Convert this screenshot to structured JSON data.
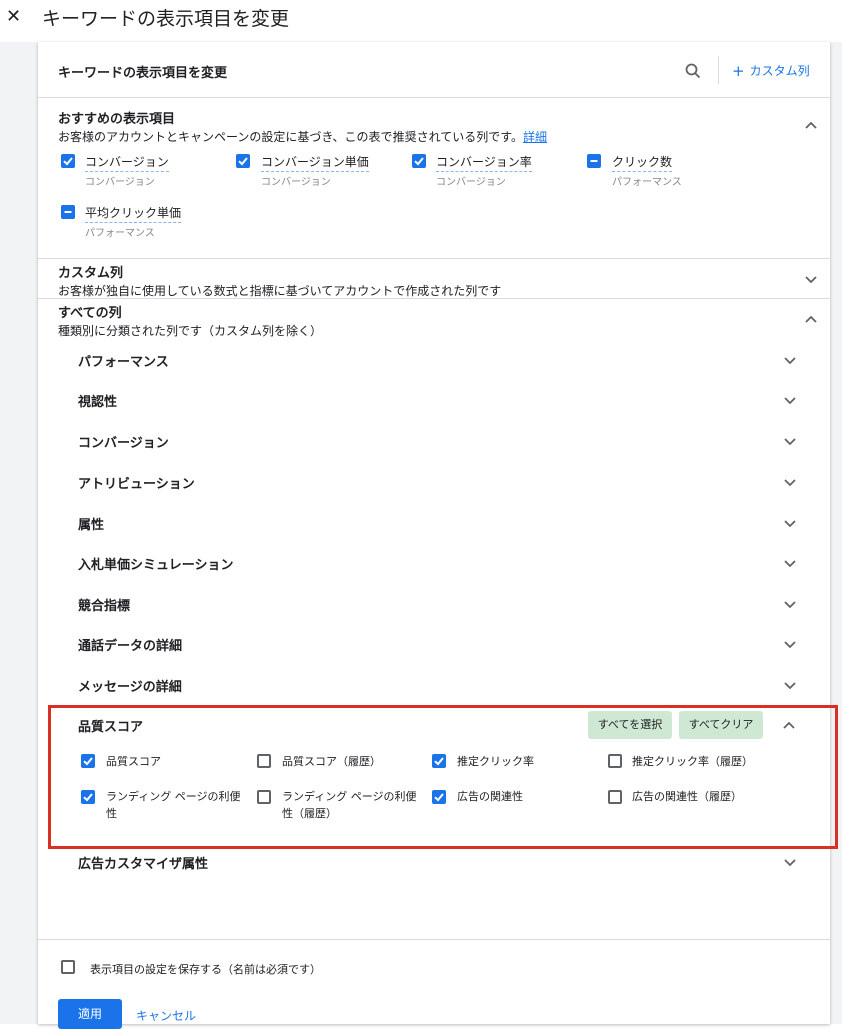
{
  "page": {
    "title": "キーワードの表示項目を変更"
  },
  "panel": {
    "header_title": "キーワードの表示項目を変更",
    "custom_column_button": "カスタム列"
  },
  "recommended": {
    "title": "おすすめの表示項目",
    "description": "お客様のアカウントとキャンペーンの設定に基づき、この表で推奨されている列です。",
    "details_link": "詳細",
    "items": [
      {
        "label": "コンバージョン",
        "category": "コンバージョン",
        "state": "checked"
      },
      {
        "label": "コンバージョン単価",
        "category": "コンバージョン",
        "state": "checked"
      },
      {
        "label": "コンバージョン率",
        "category": "コンバージョン",
        "state": "checked"
      },
      {
        "label": "クリック数",
        "category": "パフォーマンス",
        "state": "indeterminate"
      },
      {
        "label": "平均クリック単価",
        "category": "パフォーマンス",
        "state": "indeterminate"
      }
    ]
  },
  "custom_columns": {
    "title": "カスタム列",
    "description": "お客様が独自に使用している数式と指標に基づいてアカウントで作成された列です"
  },
  "all_columns": {
    "title": "すべての列",
    "description": "種類別に分類された列です（カスタム列を除く）",
    "categories": [
      "パフォーマンス",
      "視認性",
      "コンバージョン",
      "アトリビューション",
      "属性",
      "入札単価シミュレーション",
      "競合指標",
      "通話データの詳細",
      "メッセージの詳細"
    ],
    "quality_score": {
      "title": "品質スコア",
      "select_all": "すべてを選択",
      "clear_all": "すべてクリア",
      "items": [
        {
          "label": "品質スコア",
          "checked": true
        },
        {
          "label": "品質スコア（履歴）",
          "checked": false
        },
        {
          "label": "推定クリック率",
          "checked": true
        },
        {
          "label": "推定クリック率（履歴）",
          "checked": false
        },
        {
          "label": "ランディング ページの利便性",
          "checked": true
        },
        {
          "label": "ランディング ページの利便性（履歴）",
          "checked": false
        },
        {
          "label": "広告の関連性",
          "checked": true
        },
        {
          "label": "広告の関連性（履歴）",
          "checked": false
        }
      ]
    },
    "last_category": "広告カスタマイザ属性"
  },
  "footer": {
    "save_label": "表示項目の設定を保存する（名前は必須です）",
    "apply": "適用",
    "cancel": "キャンセル"
  },
  "colors": {
    "accent": "#1a73e8",
    "highlight_border": "#d93025",
    "chip_bg": "#cfe8d4"
  }
}
